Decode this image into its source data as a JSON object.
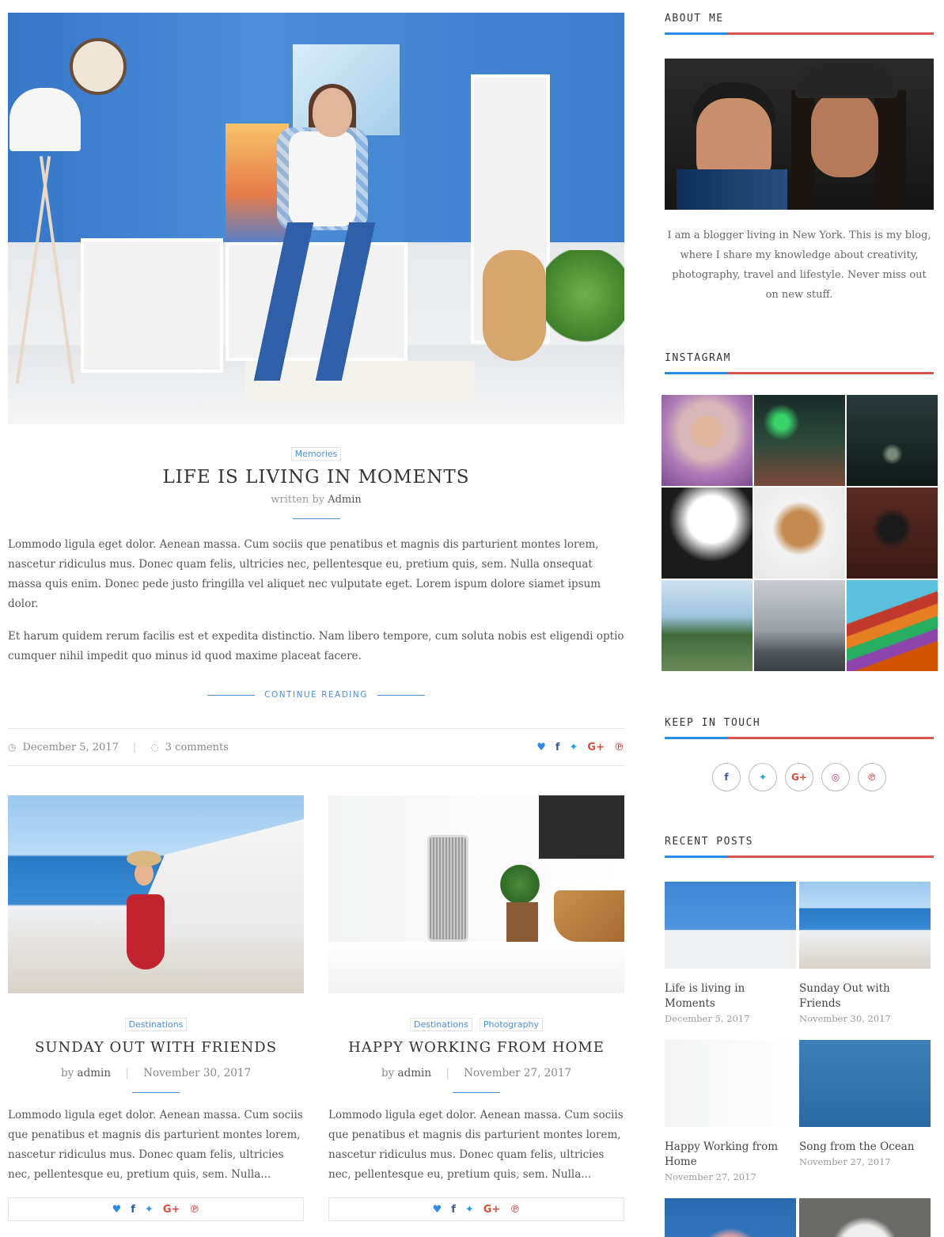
{
  "featured_post": {
    "category": "Memories",
    "title": "LIFE IS LIVING IN MOMENTS",
    "byline_prefix": "written by",
    "author": "Admin",
    "paragraphs": [
      "Lommodo ligula eget dolor. Aenean massa. Cum sociis que penatibus et magnis dis parturient montes lorem, nascetur ridiculus mus. Donec quam felis, ultricies nec, pellentesque eu, pretium quis, sem. Nulla onsequat massa quis enim. Donec pede justo fringilla vel aliquet nec vulputate eget. Lorem ispum dolore siamet ipsum dolor.",
      "Et harum quidem rerum facilis est et expedita distinctio. Nam libero tempore, cum soluta nobis est eligendi optio cumquer nihil impedit quo minus id quod maxime placeat facere."
    ],
    "continue_label": "CONTINUE READING",
    "date": "December 5, 2017",
    "comments": "3 comments",
    "date_icon": "clock-icon",
    "comments_icon": "comment-icon"
  },
  "share_icons": {
    "heart": "♥",
    "facebook": "f",
    "twitter": "🐦",
    "google": "G+",
    "pinterest": "℗"
  },
  "grid_posts": [
    {
      "categories": [
        "Destinations"
      ],
      "title": "SUNDAY OUT WITH FRIENDS",
      "author_prefix": "by",
      "author": "admin",
      "date": "November 30, 2017",
      "excerpt": "Lommodo ligula eget dolor. Aenean massa. Cum sociis que penatibus et magnis dis parturient montes lorem, nascetur ridiculus mus. Donec quam felis, ultricies nec, pellentesque eu, pretium quis, sem. Nulla..."
    },
    {
      "categories": [
        "Destinations",
        "Photography"
      ],
      "title": "HAPPY WORKING FROM HOME",
      "author_prefix": "by",
      "author": "admin",
      "date": "November 27, 2017",
      "excerpt": "Lommodo ligula eget dolor. Aenean massa. Cum sociis que penatibus et magnis dis parturient montes lorem, nascetur ridiculus mus. Donec quam felis, ultricies nec, pellentesque eu, pretium quis, sem. Nulla..."
    }
  ],
  "sidebar": {
    "about": {
      "title": "ABOUT ME",
      "text": "I am a blogger living in New York. This is my blog, where I share my knowledge about creativity, photography, travel and lifestyle. Never miss out on new stuff."
    },
    "instagram": {
      "title": "INSTAGRAM"
    },
    "keep_in_touch": {
      "title": "KEEP IN TOUCH",
      "icons": [
        {
          "name": "facebook-icon",
          "glyph": "f",
          "color": "#3b5998"
        },
        {
          "name": "twitter-icon",
          "glyph": "🐦",
          "color": "#2b9bea"
        },
        {
          "name": "google-plus-icon",
          "glyph": "G+",
          "color": "#dd4b39"
        },
        {
          "name": "instagram-icon",
          "glyph": "◎",
          "color": "#c13584"
        },
        {
          "name": "pinterest-icon",
          "glyph": "℗",
          "color": "#cc2127"
        }
      ]
    },
    "recent_posts": {
      "title": "RECENT POSTS",
      "items": [
        {
          "title": "Life is living in Moments",
          "date": "December 5, 2017"
        },
        {
          "title": "Sunday Out with Friends",
          "date": "November 30, 2017"
        },
        {
          "title": "Happy Working from Home",
          "date": "November 27, 2017"
        },
        {
          "title": "Song from the Ocean",
          "date": "November 27, 2017"
        }
      ]
    }
  },
  "colors": {
    "accent_blue": "#2b8ae6",
    "accent_red": "#d9534f",
    "link_blue": "#4d8fd6"
  },
  "separator": "|"
}
